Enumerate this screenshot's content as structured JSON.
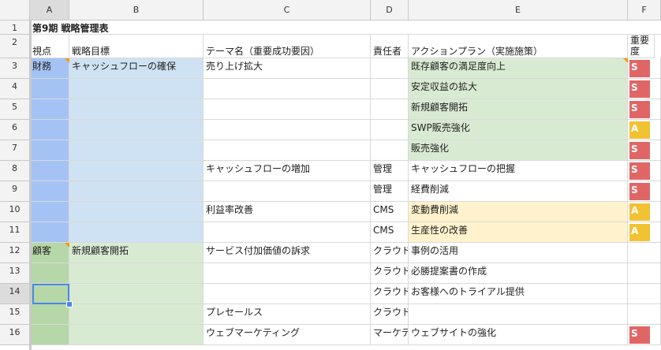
{
  "columns": [
    {
      "label": "A",
      "selected": true
    },
    {
      "label": "B",
      "selected": false
    },
    {
      "label": "C",
      "selected": false
    },
    {
      "label": "D",
      "selected": false
    },
    {
      "label": "E",
      "selected": false
    },
    {
      "label": "F",
      "selected": false
    }
  ],
  "rows": [
    {
      "label": "1",
      "selected": false
    },
    {
      "label": "2",
      "selected": false
    },
    {
      "label": "3",
      "selected": false
    },
    {
      "label": "4",
      "selected": false
    },
    {
      "label": "5",
      "selected": false
    },
    {
      "label": "6",
      "selected": false
    },
    {
      "label": "7",
      "selected": false
    },
    {
      "label": "8",
      "selected": false
    },
    {
      "label": "9",
      "selected": false
    },
    {
      "label": "10",
      "selected": false
    },
    {
      "label": "11",
      "selected": false
    },
    {
      "label": "12",
      "selected": false
    },
    {
      "label": "13",
      "selected": false
    },
    {
      "label": "14",
      "selected": true
    },
    {
      "label": "15",
      "selected": false
    },
    {
      "label": "16",
      "selected": false
    }
  ],
  "title": "第9期 戦略管理表",
  "headers": {
    "a": "視点",
    "b": "戦略目標",
    "c": "テーマ名（重要成功要因）",
    "d": "責任者",
    "e": "アクションプラン（実施施策）",
    "f": "重要度"
  },
  "data_rows": [
    {
      "a": "財務",
      "b": "キャッシュフローの確保",
      "c": "売り上げ拡大",
      "d": "",
      "e": "既存顧客の満足度向上",
      "f": "S"
    },
    {
      "a": "",
      "b": "",
      "c": "",
      "d": "",
      "e": "安定収益の拡大",
      "f": "S"
    },
    {
      "a": "",
      "b": "",
      "c": "",
      "d": "",
      "e": "新規顧客開拓",
      "f": "S"
    },
    {
      "a": "",
      "b": "",
      "c": "",
      "d": "",
      "e": "SWP販売強化",
      "f": "A"
    },
    {
      "a": "",
      "b": "",
      "c": "",
      "d": "",
      "e": "販売強化",
      "f": "S"
    },
    {
      "a": "",
      "b": "",
      "c": "キャッシュフローの増加",
      "d": "管理",
      "e": "キャッシュフローの把握",
      "f": "S"
    },
    {
      "a": "",
      "b": "",
      "c": "",
      "d": "管理",
      "e": "経費削減",
      "f": "S"
    },
    {
      "a": "",
      "b": "",
      "c": "利益率改善",
      "d": "CMS",
      "e": "変動費削減",
      "f": "A"
    },
    {
      "a": "",
      "b": "",
      "c": "",
      "d": "CMS",
      "e": "生産性の改善",
      "f": "A"
    },
    {
      "a": "顧客",
      "b": "新規顧客開拓",
      "c": "サービス付加価値の訴求",
      "d": "クラウド",
      "e": "事例の活用",
      "f": ""
    },
    {
      "a": "",
      "b": "",
      "c": "",
      "d": "クラウド",
      "e": "必勝提案書の作成",
      "f": ""
    },
    {
      "a": "",
      "b": "",
      "c": "",
      "d": "クラウド",
      "e": "お客様へのトライアル提供",
      "f": ""
    },
    {
      "a": "",
      "b": "",
      "c": "プレセールス",
      "d": "クラウド",
      "e": "",
      "f": ""
    },
    {
      "a": "",
      "b": "",
      "c": "ウェブマーケティング",
      "d": "マーケティ",
      "e": "ウェブサイトの強化",
      "f": "S"
    }
  ],
  "colors": {
    "blue_dark": "#a4c2f4",
    "blue_light": "#cfe2f3",
    "green_dark": "#b6d7a8",
    "green_light": "#d9ead3",
    "yellow": "#fff2cc",
    "badge_s": "#e06666",
    "badge_a": "#f1c232",
    "selection": "#4a86e8"
  }
}
